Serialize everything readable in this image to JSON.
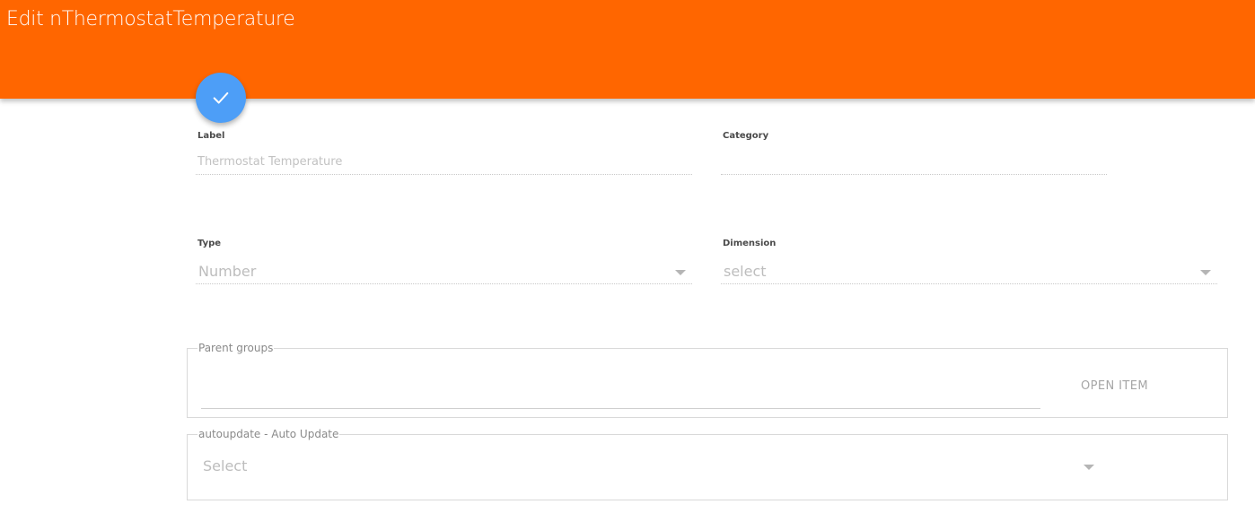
{
  "header": {
    "title": "Edit nThermostatTemperature"
  },
  "save_fab": {
    "icon": "check-icon"
  },
  "form": {
    "label": {
      "label": "Label",
      "value": "Thermostat Temperature"
    },
    "category": {
      "label": "Category",
      "value": ""
    },
    "type": {
      "label": "Type",
      "selected": "Number"
    },
    "dimension": {
      "label": "Dimension",
      "selected": "select"
    },
    "parent_groups": {
      "legend": "Parent groups",
      "value": "",
      "open_item_label": "OPEN ITEM"
    },
    "autoupdate": {
      "legend": "autoupdate - Auto Update",
      "selected": "Select"
    }
  },
  "colors": {
    "header_bg": "#ff6600",
    "fab_bg": "#4d9ef7"
  }
}
